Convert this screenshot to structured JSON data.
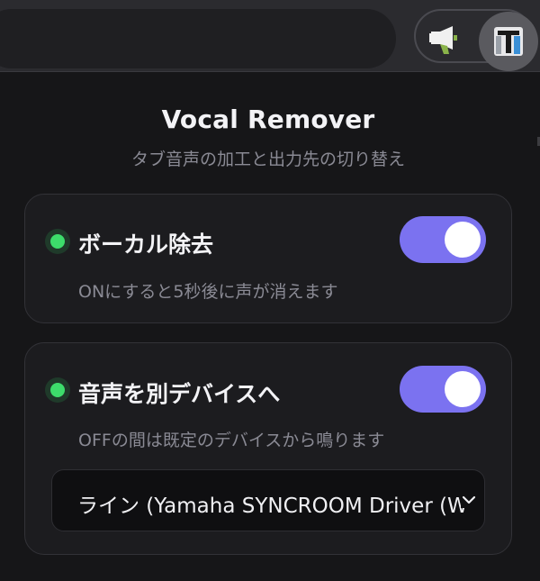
{
  "toolbar": {
    "extensions": [
      {
        "icon": "megaphone-icon"
      },
      {
        "icon": "vocal-remover-extension-icon"
      }
    ]
  },
  "popup": {
    "title": "Vocal Remover",
    "subtitle": "タブ音声の加工と出力先の切り替え",
    "vocal_removal": {
      "label": "ボーカル除去",
      "description": "ONにすると5秒後に声が消えます",
      "enabled": true,
      "status_color": "#3ddc6b"
    },
    "output_device": {
      "label": "音声を別デバイスへ",
      "description": "OFFの間は既定のデバイスから鳴ります",
      "enabled": true,
      "status_color": "#3ddc6b",
      "selected_device": "ライン (Yamaha SYNCROOM Driver (W"
    }
  },
  "colors": {
    "accent": "#7b72f0",
    "status_on": "#3ddc6b",
    "background": "#161618"
  }
}
